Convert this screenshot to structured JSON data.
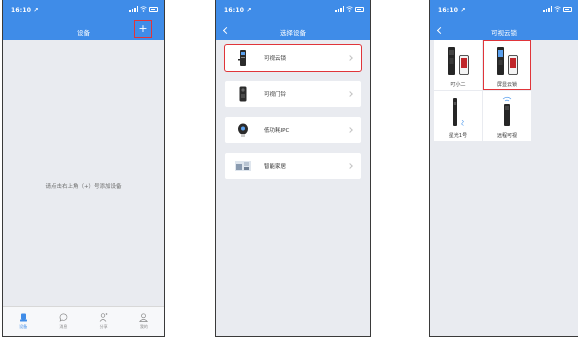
{
  "status": {
    "time": "16:10 ↗"
  },
  "screen1": {
    "title": "设备",
    "add_icon": "plus-icon",
    "empty_hint": "请点击右上角（+）号添加设备",
    "tabs": [
      {
        "label": "设备",
        "icon": "device-icon",
        "active": true
      },
      {
        "label": "消息",
        "icon": "message-icon",
        "active": false
      },
      {
        "label": "分享",
        "icon": "share-icon",
        "active": false
      },
      {
        "label": "我的",
        "icon": "user-icon",
        "active": false
      }
    ]
  },
  "screen2": {
    "title": "选择设备",
    "items": [
      {
        "label": "可视云锁",
        "icon": "smart-lock-icon",
        "selected": true
      },
      {
        "label": "可视门铃",
        "icon": "doorbell-icon",
        "selected": false
      },
      {
        "label": "低功耗IPC",
        "icon": "camera-icon",
        "selected": false
      },
      {
        "label": "智能家居",
        "icon": "smart-home-icon",
        "selected": false
      }
    ]
  },
  "screen3": {
    "title": "可视云锁",
    "products": [
      {
        "label": "叮小二",
        "icon": "lock-with-phone-icon",
        "selected": false
      },
      {
        "label": "屏显云锁",
        "icon": "screen-lock-with-phone-icon",
        "selected": true
      },
      {
        "label": "星光1号",
        "icon": "slim-lock-icon",
        "selected": false
      },
      {
        "label": "远程可视",
        "icon": "remote-view-lock-icon",
        "selected": false
      }
    ]
  },
  "colors": {
    "header": "#3f8ce8",
    "highlight": "#e0353a",
    "background": "#e9ebf0"
  }
}
